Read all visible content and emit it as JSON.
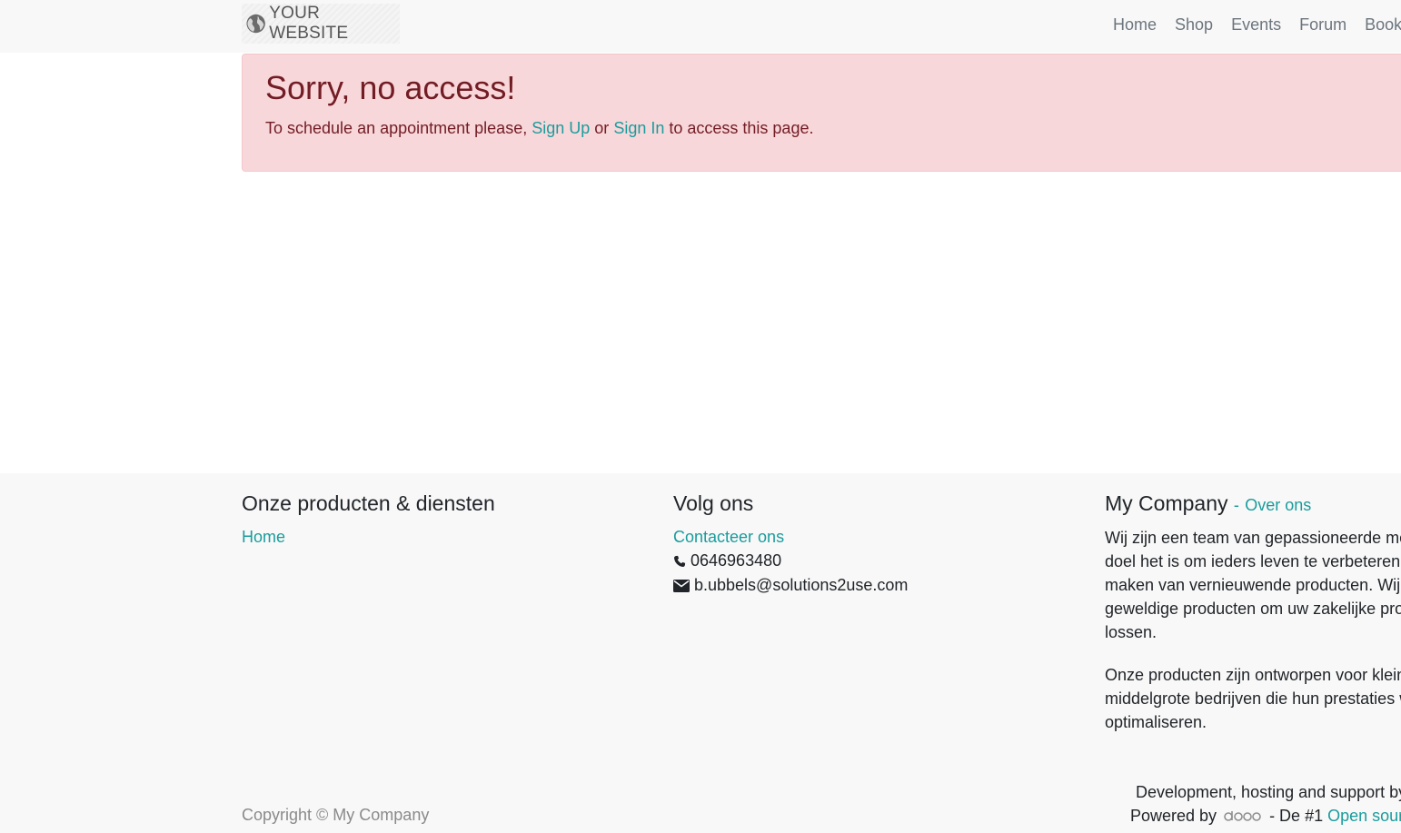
{
  "header": {
    "logo_text": "YOUR WEBSITE",
    "nav": [
      "Home",
      "Shop",
      "Events",
      "Forum",
      "Book"
    ]
  },
  "alert": {
    "title": "Sorry, no access!",
    "text_before": "To schedule an appointment please,",
    "sign_up": "Sign Up",
    "or": "or",
    "sign_in": "Sign In",
    "text_after": "to access this page."
  },
  "footer": {
    "col1": {
      "heading": "Onze producten & diensten",
      "link": "Home"
    },
    "col2": {
      "heading": "Volg ons",
      "contact_link": "Contacteer ons",
      "phone": "0646963480",
      "email": "b.ubbels@solutions2use.com"
    },
    "col3": {
      "heading": "My Company",
      "separator": "-",
      "about_link": "Over ons",
      "para1": [
        "Wij zijn een team van gepassioneerde mer",
        "doel het is om ieders leven te verbeteren d",
        "maken van vernieuwende producten. Wij b",
        "geweldige producten om uw zakelijke prob",
        "lossen."
      ],
      "para2": [
        "Onze producten zijn ontworpen voor kleine",
        "middelgrote bedrijven die hun prestaties w",
        "optimaliseren."
      ]
    },
    "copyright": "Copyright © My Company",
    "credits_line1": "Development, hosting and support by",
    "powered_by": "Powered by",
    "odoo_logo": "odoo",
    "tagline": "- De #1",
    "open_source_link": "Open sourc"
  },
  "colors": {
    "accent": "#1a9c9c",
    "alert_bg": "#f8d7da",
    "alert_text": "#721c24",
    "footer_bg": "#f8f8f8"
  },
  "icons": [
    "globe-icon",
    "phone-icon",
    "envelope-icon"
  ]
}
